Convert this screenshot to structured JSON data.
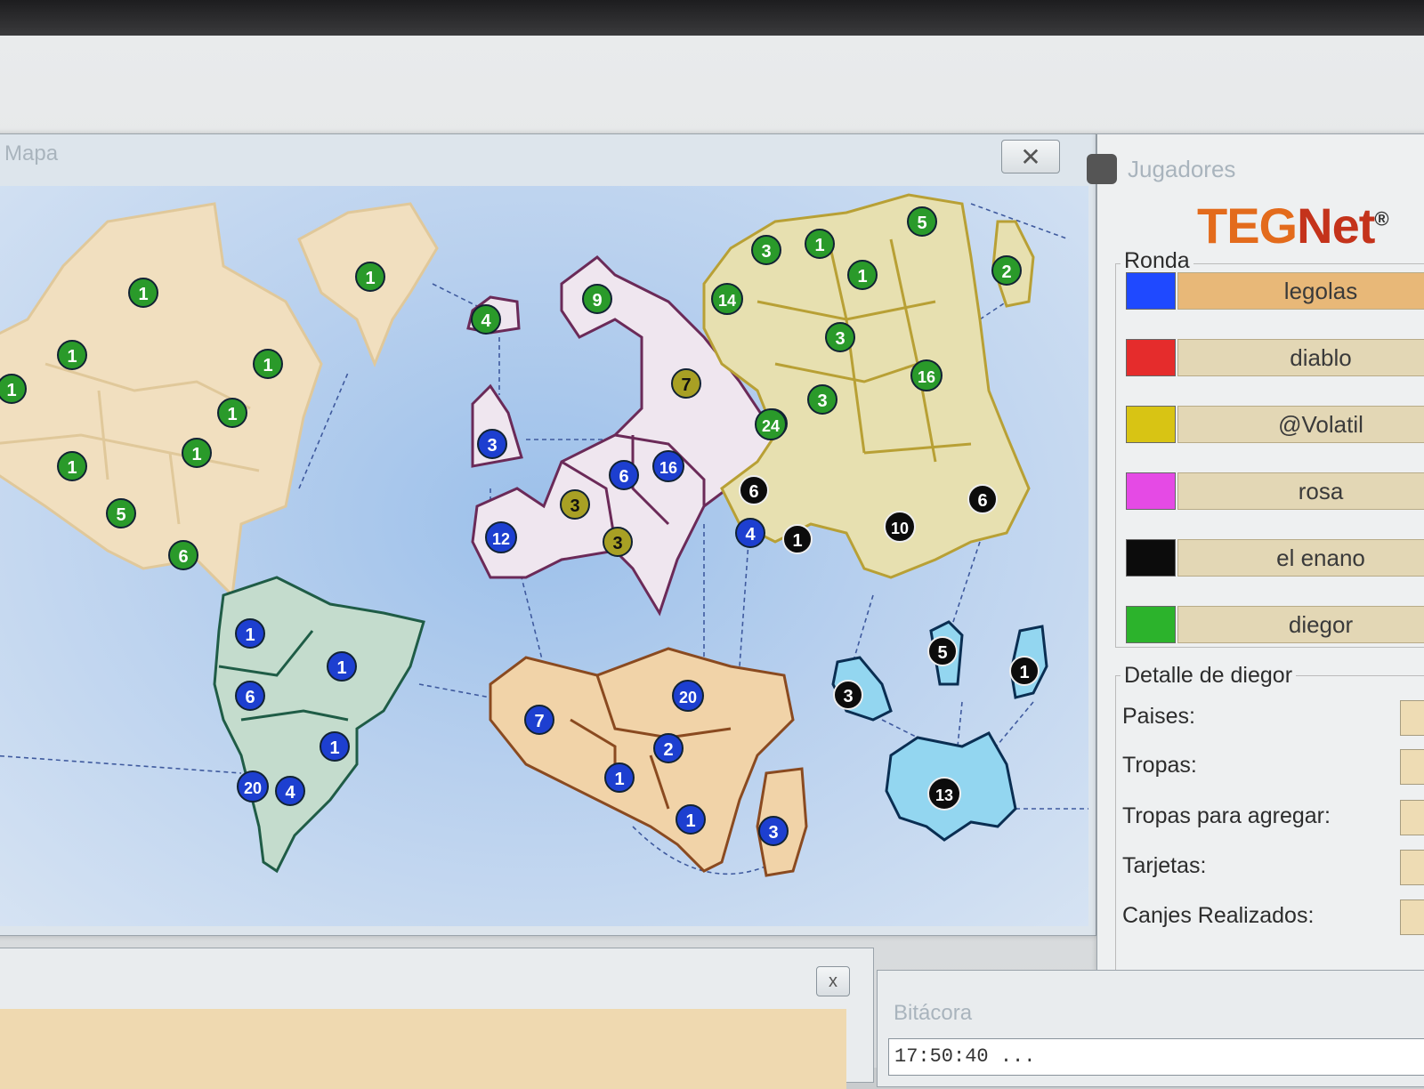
{
  "map_window": {
    "title": "Mapa",
    "close_glyph": "✕"
  },
  "players_window": {
    "title": "Jugadores",
    "logo": {
      "part1": "TEG",
      "part2": "Net",
      "mark": "®"
    },
    "round_label": "Ronda",
    "players": [
      {
        "name": "legolas",
        "color": "#1f49ff",
        "active": true
      },
      {
        "name": "diablo",
        "color": "#e52c2c",
        "active": false
      },
      {
        "name": "@Volatil",
        "color": "#d8c414",
        "active": false
      },
      {
        "name": "rosa",
        "color": "#e54ae5",
        "active": false
      },
      {
        "name": "el enano",
        "color": "#0c0c0c",
        "active": false
      },
      {
        "name": "diegor",
        "color": "#2cb32c",
        "active": false
      }
    ],
    "detail": {
      "label": "Detalle de diegor",
      "fields": [
        "Paises:",
        "Tropas:",
        "Tropas para agregar:",
        "Tarjetas:",
        "Canjes Realizados:"
      ]
    }
  },
  "bottom_left": {
    "close_glyph": "x"
  },
  "log": {
    "title": "Bitácora",
    "first_line": "17:50:40 ..."
  },
  "armies": {
    "green": [
      "1",
      "1",
      "1",
      "1",
      "1",
      "1",
      "1",
      "1",
      "5",
      "6",
      "1",
      "4",
      "9",
      "3",
      "1",
      "5",
      "2",
      "14",
      "3",
      "3",
      "3",
      "16",
      "24"
    ],
    "olive": [
      "7",
      "3",
      "3"
    ],
    "blue": [
      "3",
      "6",
      "16",
      "12",
      "4",
      "1",
      "1",
      "6",
      "1",
      "20",
      "4",
      "7",
      "20",
      "2",
      "1",
      "1",
      "3"
    ],
    "black": [
      "6",
      "1",
      "10",
      "6",
      "5",
      "1",
      "3",
      "13"
    ]
  },
  "army_colors": {
    "green": "#2a9a2a",
    "olive": "#a8a024",
    "blue": "#1d3fd0",
    "black": "#0c0c0c"
  }
}
